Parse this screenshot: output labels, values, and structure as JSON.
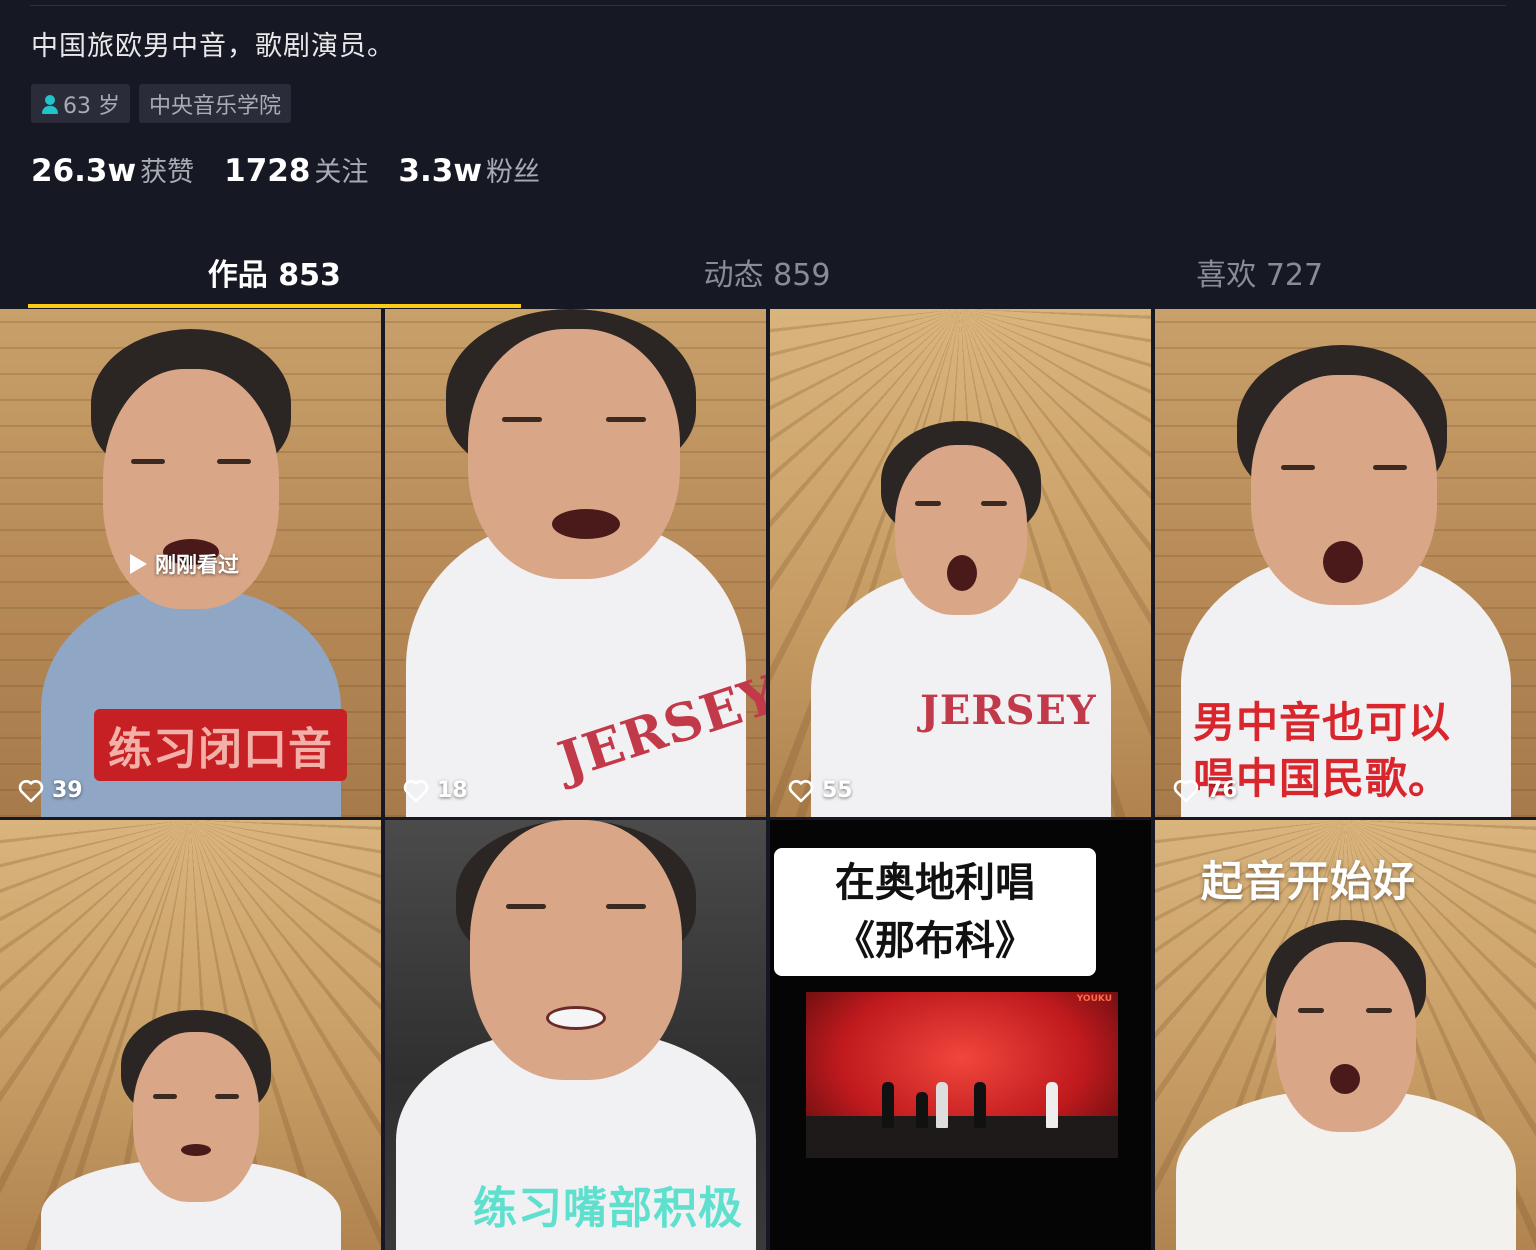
{
  "profile": {
    "bio": "中国旅欧男中音，歌剧演员。",
    "tags": [
      {
        "label": "63 岁",
        "icon": "user-icon"
      },
      {
        "label": "中央音乐学院"
      }
    ],
    "stats": [
      {
        "value": "26.3w",
        "label": "获赞"
      },
      {
        "value": "1728",
        "label": "关注"
      },
      {
        "value": "3.3w",
        "label": "粉丝"
      }
    ]
  },
  "tabs": [
    {
      "label": "作品 853",
      "active": true
    },
    {
      "label": "动态 859",
      "active": false
    },
    {
      "label": "喜欢 727",
      "active": false
    }
  ],
  "videos": [
    {
      "likes": "39",
      "caption": "练习闭口音",
      "overlay": "刚刚看过"
    },
    {
      "likes": "18",
      "caption": "JERSEY"
    },
    {
      "likes": "55",
      "caption": "JERSEY"
    },
    {
      "likes": "76",
      "caption_line1": "男中音也可以",
      "caption_line2": "唱中国民歌。"
    },
    {
      "likes": null
    },
    {
      "likes": null,
      "caption": "练习嘴部积极"
    },
    {
      "likes": null,
      "title_line1": "在奥地利唱",
      "title_line2": "《那布科》",
      "watermark": "YOUKU"
    },
    {
      "likes": null,
      "caption": "起音开始好"
    }
  ],
  "colors": {
    "background": "#161823",
    "accent": "#facc15",
    "tag_bg": "#2a2d39",
    "muted_text": "#a9abb3",
    "user_icon": "#20c4cb"
  }
}
